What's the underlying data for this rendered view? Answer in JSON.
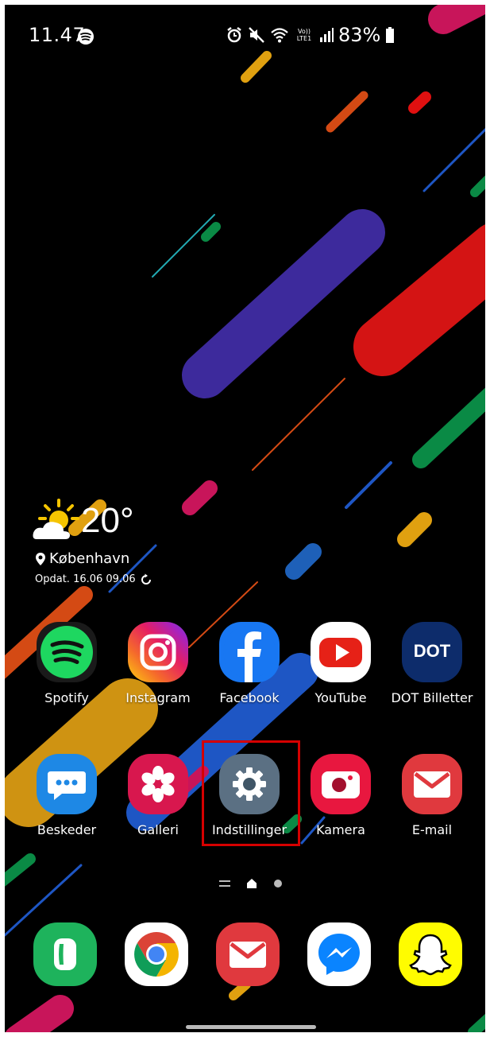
{
  "status_bar": {
    "time": "11.47",
    "network_label": "Vo)) LTE1",
    "battery": "83%",
    "icons": [
      "spotify-icon",
      "alarm-icon",
      "mute-icon",
      "wifi-icon",
      "signal-icon",
      "battery-icon"
    ]
  },
  "weather": {
    "temperature": "20°",
    "location": "København",
    "updated": "Opdat. 16.06 09.06",
    "icons": [
      "partly-cloudy-icon",
      "location-pin-icon",
      "refresh-icon"
    ]
  },
  "apps_row1": [
    {
      "label": "Spotify",
      "icon": "spotify-icon"
    },
    {
      "label": "Instagram",
      "icon": "instagram-icon"
    },
    {
      "label": "Facebook",
      "icon": "facebook-icon"
    },
    {
      "label": "YouTube",
      "icon": "youtube-icon"
    },
    {
      "label": "DOT Billetter",
      "icon": "dot-icon",
      "icon_text": "DOT"
    }
  ],
  "apps_row2": [
    {
      "label": "Beskeder",
      "icon": "messages-icon"
    },
    {
      "label": "Galleri",
      "icon": "gallery-icon"
    },
    {
      "label": "Indstillinger",
      "icon": "settings-gear-icon",
      "highlighted": true
    },
    {
      "label": "Kamera",
      "icon": "camera-icon"
    },
    {
      "label": "E-mail",
      "icon": "email-icon"
    }
  ],
  "dock": [
    {
      "icon": "phone-icon"
    },
    {
      "icon": "chrome-icon"
    },
    {
      "icon": "email-icon"
    },
    {
      "icon": "messenger-icon"
    },
    {
      "icon": "snapchat-icon"
    }
  ],
  "page_indicator": {
    "pages": [
      "menu",
      "home",
      "page"
    ],
    "current": "home"
  },
  "colors": {
    "highlight": "#d50000",
    "wallpaper_bg": "#000000",
    "wallpaper_accents": [
      "#3d2a9c",
      "#d41414",
      "#0a8a45",
      "#e0a010",
      "#c8155a",
      "#1e56c4",
      "#d44a14"
    ]
  }
}
